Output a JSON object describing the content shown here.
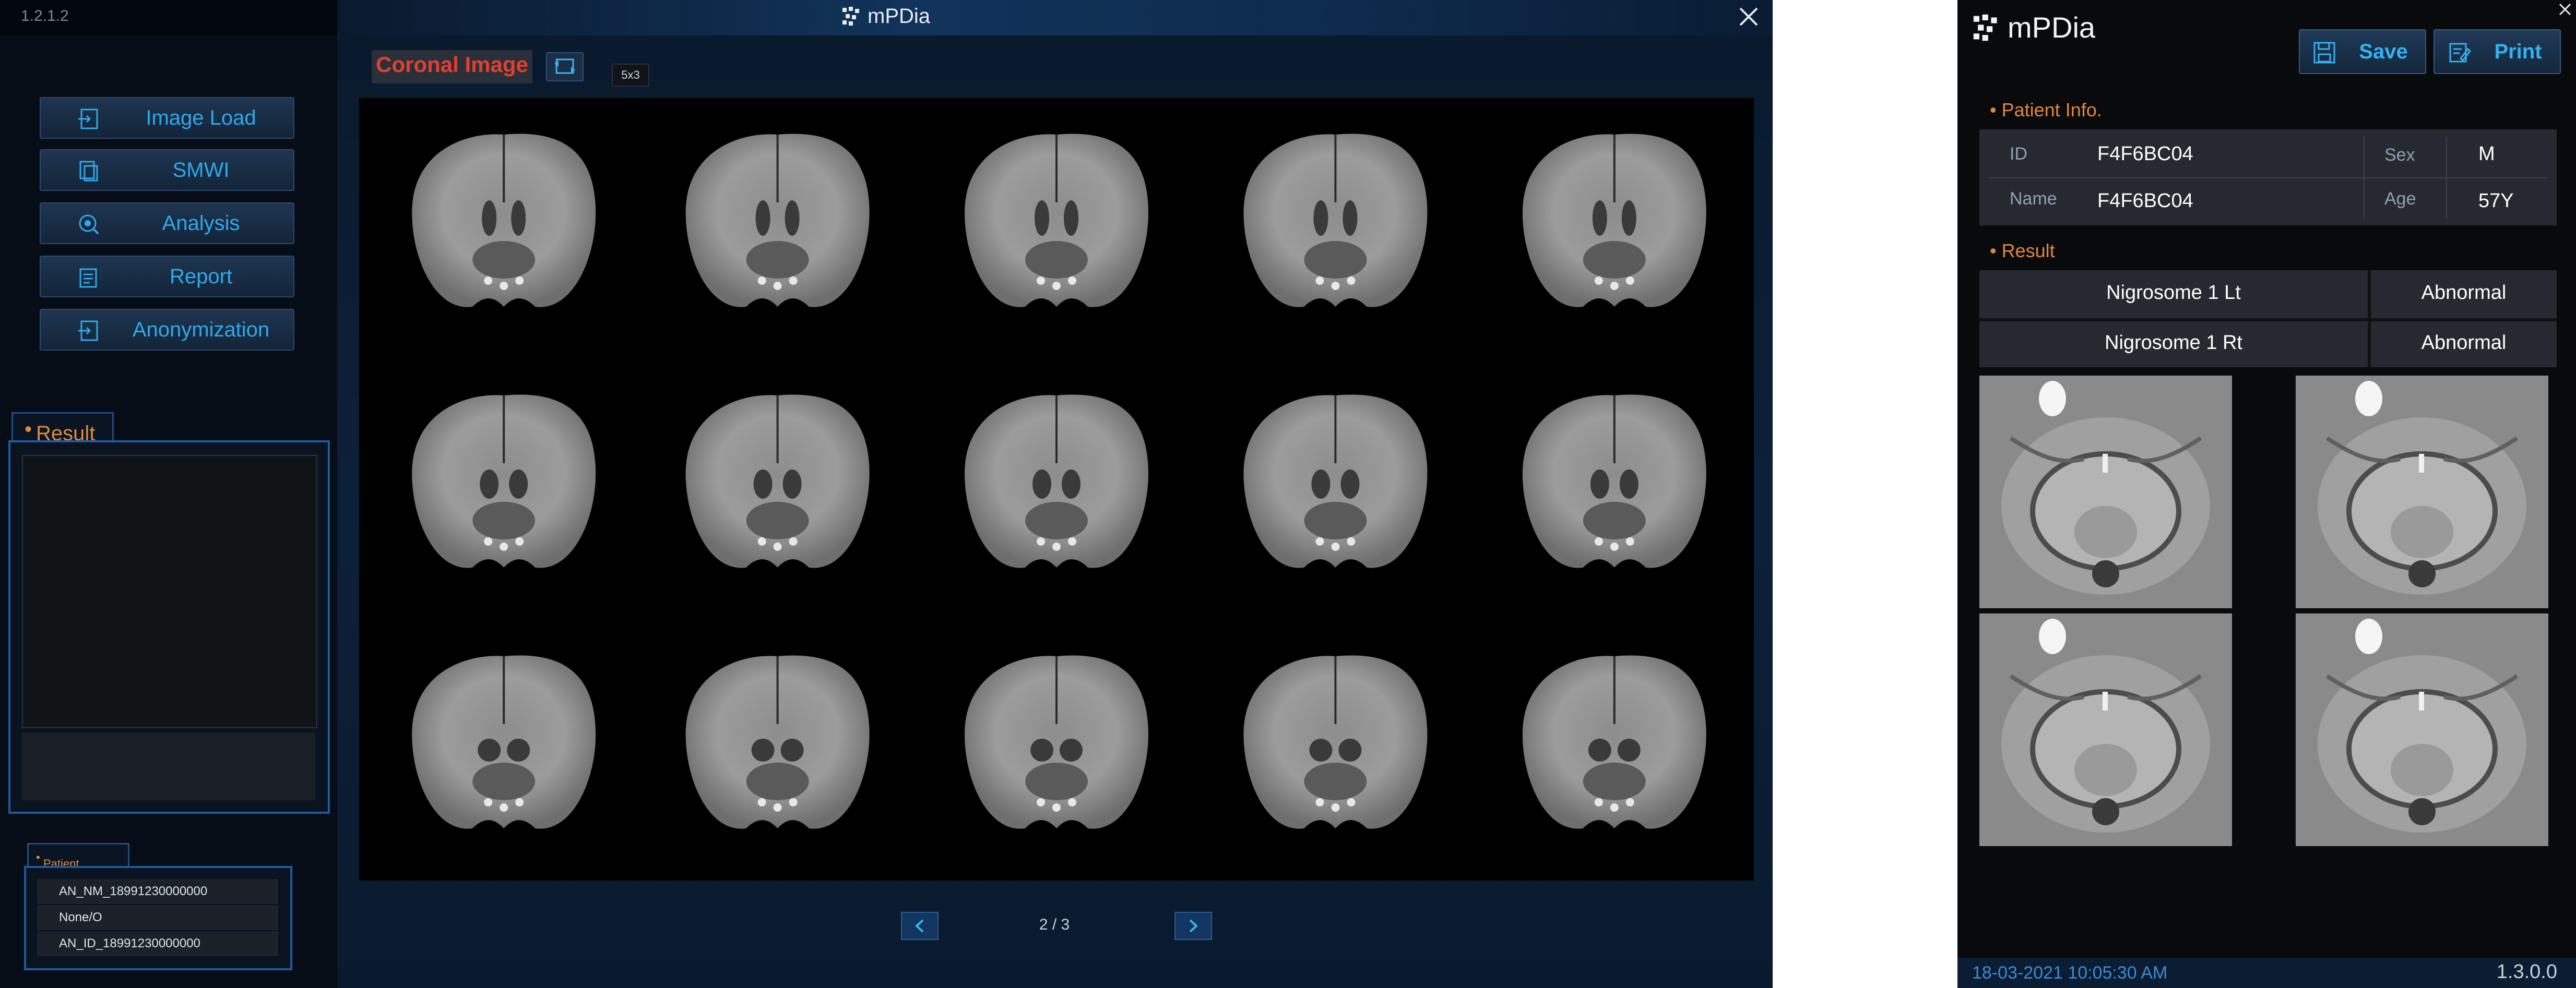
{
  "left_window": {
    "version": "1.2.1.2",
    "app_name": "mPDia",
    "nav": [
      {
        "label": "Image Load",
        "icon": "image-load-icon"
      },
      {
        "label": "SMWI",
        "icon": "smwi-icon"
      },
      {
        "label": "Analysis",
        "icon": "analysis-icon"
      },
      {
        "label": "Report",
        "icon": "report-icon"
      },
      {
        "label": "Anonymization",
        "icon": "anonymization-icon"
      }
    ],
    "result_label": "Result",
    "patient_info_label": "Patient Info.",
    "patient_info_rows": [
      "AN_NM_18991230000000",
      "None/O",
      "AN_ID_18991230000000"
    ],
    "viewer": {
      "title": "Coronal Image",
      "layout": "5x3",
      "page": "2 / 3",
      "slices": 15
    },
    "colors": {
      "accent": "#2fa9ea",
      "title_red": "#e1402f",
      "section_orange": "#e08b3a"
    }
  },
  "right_window": {
    "app_name": "mPDia",
    "save_label": "Save",
    "print_label": "Print",
    "patient_info_label": "Patient Info.",
    "patient": {
      "id_key": "ID",
      "id": "F4F6BC04",
      "sex_key": "Sex",
      "sex": "M",
      "name_key": "Name",
      "name": "F4F6BC04",
      "age_key": "Age",
      "age": "57Y"
    },
    "result_label": "Result",
    "results": [
      {
        "name": "Nigrosome 1 Lt",
        "value": "Abnormal"
      },
      {
        "name": "Nigrosome 1 Rt",
        "value": "Abnormal"
      }
    ],
    "datetime": "18-03-2021  10:05:30 AM",
    "version": "1.3.0.0"
  }
}
